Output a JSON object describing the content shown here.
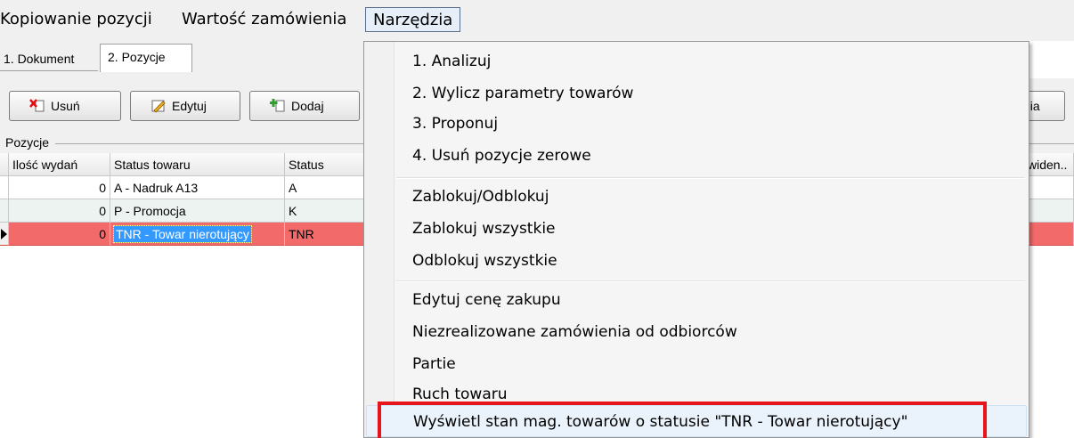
{
  "menubar": {
    "items": [
      "Kopiowanie pozycji",
      "Wartość zamówienia",
      "Narzędzia"
    ]
  },
  "tabs": [
    "1. Dokument",
    "2. Pozycje"
  ],
  "toolbar": {
    "delete_label": "Usuń",
    "edit_label": "Edytuj",
    "add_label": "Dodaj",
    "right_label": "nia"
  },
  "group_label": "Pozycje",
  "grid": {
    "columns": [
      "Ilość wydań",
      "Status towaru",
      "Status",
      "widen.."
    ],
    "rows": [
      {
        "qty": "0",
        "status_towaru": "A - Nadruk A13",
        "status": "A",
        "extra": ""
      },
      {
        "qty": "0",
        "status_towaru": "P - Promocja",
        "status": "K",
        "extra": ""
      },
      {
        "qty": "0",
        "status_towaru": "TNR - Towar nierotujący",
        "status": "TNR",
        "extra": ""
      }
    ]
  },
  "dropdown": {
    "items": [
      "1. Analizuj",
      "2. Wylicz parametry towarów",
      "3. Proponuj",
      "4. Usuń pozycje zerowe",
      "Zablokuj/Odblokuj",
      "Zablokuj wszystkie",
      "Odblokuj wszystkie",
      "Edytuj cenę zakupu",
      "Niezrealizowane zamówienia od odbiorców",
      "Partie",
      "Ruch towaru",
      "Wyświetl stan mag. towarów o statusie \"TNR - Towar nierotujący\""
    ]
  },
  "colors": {
    "selected_row": "#f36a6a",
    "selection": "#3399ff",
    "highlight_box": "#e8141b"
  }
}
